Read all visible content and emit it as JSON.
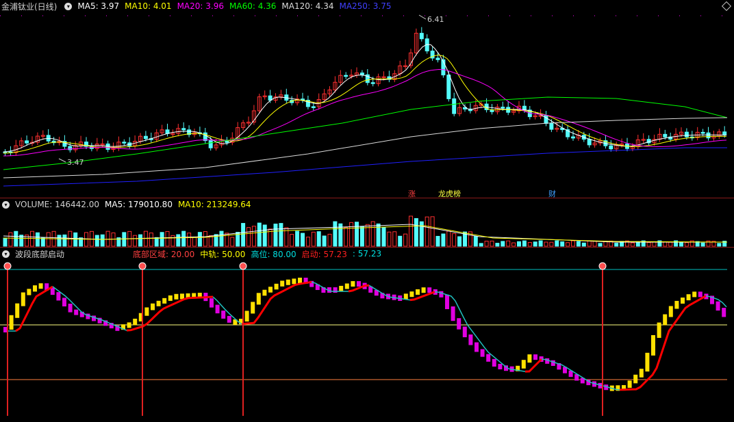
{
  "main": {
    "title": "金浦钛业(日线)",
    "ma": [
      {
        "label": "MA5: 3.97",
        "color": "#ffffff"
      },
      {
        "label": "MA10: 4.01",
        "color": "#ffff00"
      },
      {
        "label": "MA20: 3.96",
        "color": "#ff00ff"
      },
      {
        "label": "MA60: 4.36",
        "color": "#00ff00"
      },
      {
        "label": "MA120: 4.34",
        "color": "#dcdcdc"
      },
      {
        "label": "MA250: 3.75",
        "color": "#4040ff"
      }
    ],
    "high_label": "6.41",
    "low_label": "3.47",
    "markers": [
      {
        "text": "涨",
        "color": "#ff4040"
      },
      {
        "text": "龙虎榜",
        "color": "#ffff40"
      },
      {
        "text": "财",
        "color": "#40a0ff"
      }
    ],
    "corner_icon": "diamond-icon"
  },
  "volume": {
    "label": "VOLUME: 146442.00",
    "ma5": "MA5: 179010.80",
    "ma10": "MA10: 213249.64"
  },
  "indicator": {
    "title": "波段底部启动",
    "items": [
      {
        "label": "底部区域: 20.00",
        "color": "#ff4040"
      },
      {
        "label": "中轨: 50.00",
        "color": "#ffff00"
      },
      {
        "label": "高位: 80.00",
        "color": "#00e0e0"
      },
      {
        "label": "启动: 57.23",
        "color": "#ff2020"
      },
      {
        "label": ": 57.23",
        "color": "#00e0e0"
      }
    ]
  },
  "colors": {
    "up": "#ff3030",
    "down": "#54fcfc",
    "ma5": "#ffffff",
    "ma10": "#ffff00",
    "ma20": "#ff00ff",
    "ma60": "#00ff00",
    "ma120": "#dcdcdc",
    "ma250": "#2020ff"
  }
}
